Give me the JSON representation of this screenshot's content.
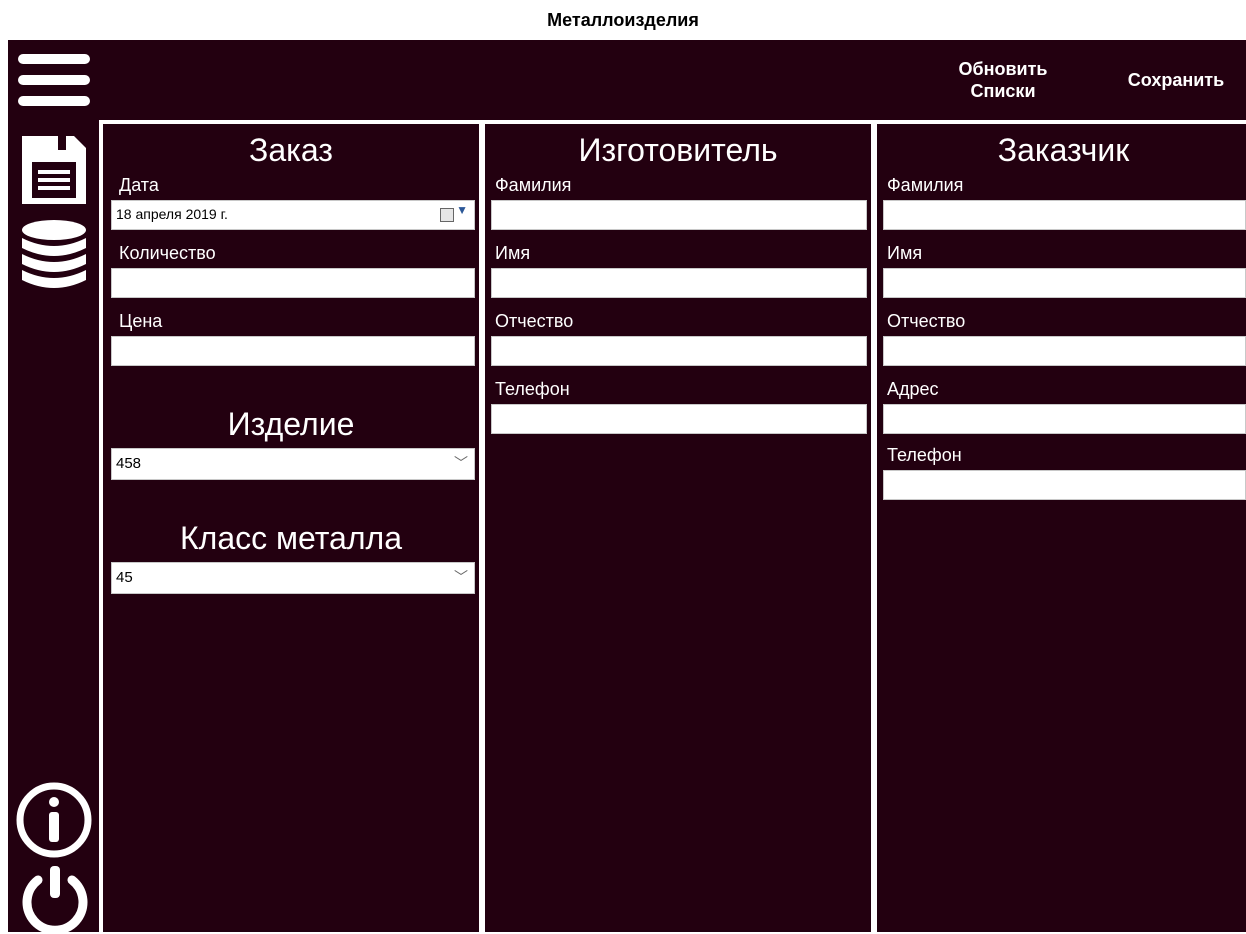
{
  "window": {
    "title": "Металлоизделия"
  },
  "toolbar": {
    "refresh_line1": "Обновить",
    "refresh_line2": "Списки",
    "save_label": "Сохранить"
  },
  "sidebar": {
    "icons": [
      "menu-icon",
      "save-icon",
      "database-icon",
      "info-icon",
      "power-icon"
    ]
  },
  "order": {
    "title": "Заказ",
    "date_label": "Дата",
    "date_value": "18  апреля  2019 г.",
    "quantity_label": "Количество",
    "quantity_value": "",
    "price_label": "Цена",
    "price_value": "",
    "product_title": "Изделие",
    "product_value": "458",
    "metal_title": "Класс металла",
    "metal_value": "45"
  },
  "manufacturer": {
    "title": "Изготовитель",
    "surname_label": "Фамилия",
    "name_label": "Имя",
    "patronymic_label": "Отчество",
    "phone_label": "Телефон"
  },
  "customer": {
    "title": "Заказчик",
    "surname_label": "Фамилия",
    "name_label": "Имя",
    "patronymic_label": "Отчество",
    "address_label": "Адрес",
    "phone_label": "Телефон"
  },
  "colors": {
    "background": "#230010",
    "foreground": "#ffffff"
  }
}
